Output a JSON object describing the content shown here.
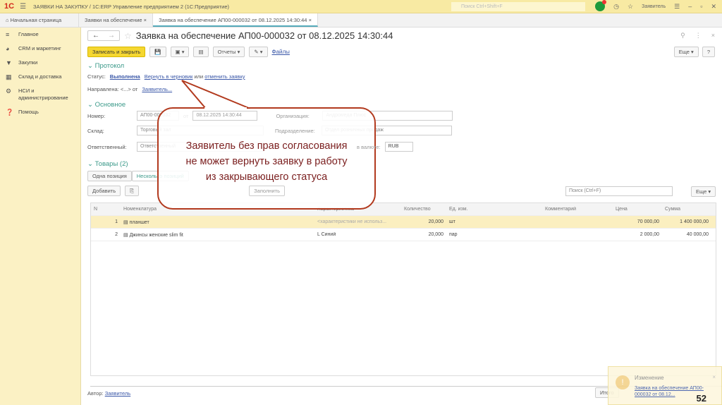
{
  "app": {
    "logo": "1С",
    "title": "ЗАЯВКИ НА ЗАКУПКУ / 1С:ERP Управление предприятием 2  (1С:Предприятие)",
    "search_placeholder": "Поиск Ctrl+Shift+F",
    "user": "Заявитель"
  },
  "tabs": [
    {
      "label": "Начальная страница"
    },
    {
      "label": "Заявки на обеспечение"
    },
    {
      "label": "Заявка на обеспечение АП00-000032 от 08.12.2025 14:30:44"
    }
  ],
  "sidebar": {
    "items": [
      {
        "label": "Главное",
        "icon": "menu-icon"
      },
      {
        "label": "CRM и маркетинг",
        "icon": "chart-icon"
      },
      {
        "label": "Закупки",
        "icon": "cart-icon"
      },
      {
        "label": "Склад и доставка",
        "icon": "warehouse-icon"
      },
      {
        "label": "НСИ и администрирование",
        "icon": "gear-icon"
      },
      {
        "label": "Помощь",
        "icon": "help-icon"
      }
    ]
  },
  "form": {
    "title": "Заявка на обеспечение АП00-000032 от 08.12.2025 14:30:44",
    "toolbar": {
      "save_close": "Записать и закрыть",
      "reports": "Отчеты",
      "files": "Файлы",
      "more": "Еще",
      "help": "?"
    },
    "protocol": {
      "header": "Протокол",
      "status_label": "Статус:",
      "status": "Выполнена",
      "return_link": "Вернуть в черновик",
      "or": "или",
      "cancel_link": "отменить заявку",
      "directed": "Направлена: <...> от",
      "directed_by": "Заявитель..."
    },
    "main": {
      "header": "Основное",
      "number_label": "Номер:",
      "number": "АП00-000032",
      "from": "от",
      "date": "08.12.2025 14:30:44",
      "org_label": "Организация:",
      "org": "Андромеда Плюс",
      "warehouse_label": "Склад:",
      "warehouse": "Торговый зал",
      "dept_label": "Подразделение:",
      "dept": "Отдел розничных продаж",
      "resp_label": "Ответственный:",
      "resp": "Ответственный",
      "currency_label": "в валюте:",
      "currency": "RUB"
    },
    "goods": {
      "header": "Товары (2)",
      "tab1": "Одна позиция",
      "tab2": "Несколько позиций",
      "add": "Добавить",
      "fill": "Заполнить",
      "search_placeholder": "Поиск (Ctrl+F)",
      "more": "Еще",
      "columns": [
        "N",
        "Номенклатура",
        "Характеристика",
        "Количество",
        "Ед. изм.",
        "Комментарий",
        "Цена",
        "Сумма"
      ],
      "rows": [
        {
          "n": "1",
          "item": "планшет",
          "char": "<характеристики не использ...",
          "qty": "20,000",
          "unit": "шт",
          "comment": "",
          "price": "70 000,00",
          "sum": "1 400 000,00"
        },
        {
          "n": "2",
          "item": "Джинсы женские slim fit",
          "char": "L Синий",
          "qty": "20,000",
          "unit": "пар",
          "comment": "",
          "price": "2 000,00",
          "sum": "40 000,00"
        }
      ]
    },
    "footer": {
      "author_label": "Автор:",
      "author": "Заявитель",
      "totals": "Итого"
    }
  },
  "callout": {
    "line1": "Заявитель без прав согласования",
    "line2": "не может вернуть заявку в работу",
    "line3": "из закрывающего статуса"
  },
  "toast": {
    "title": "Изменение",
    "text": "Заявка на обеспечение АП00-000032 от 08.12..."
  },
  "page_number": "52"
}
